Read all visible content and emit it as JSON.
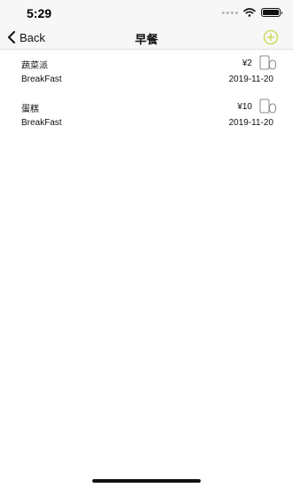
{
  "status_bar": {
    "time": "5:29"
  },
  "nav": {
    "back_label": "Back",
    "title": "早餐"
  },
  "items": [
    {
      "name": "蔬菜派",
      "price": "¥2",
      "category": "BreakFast",
      "date": "2019-11-20"
    },
    {
      "name": "蛋糕",
      "price": "¥10",
      "category": "BreakFast",
      "date": "2019-11-20"
    }
  ],
  "colors": {
    "accent": "#c8d84a",
    "toggle_outline": "#8a8a8a",
    "nav_background": "#f7f7f7"
  },
  "icons": {
    "back": "chevron-left-icon",
    "add": "plus-circle-icon",
    "toggle": "toggle-icon"
  }
}
